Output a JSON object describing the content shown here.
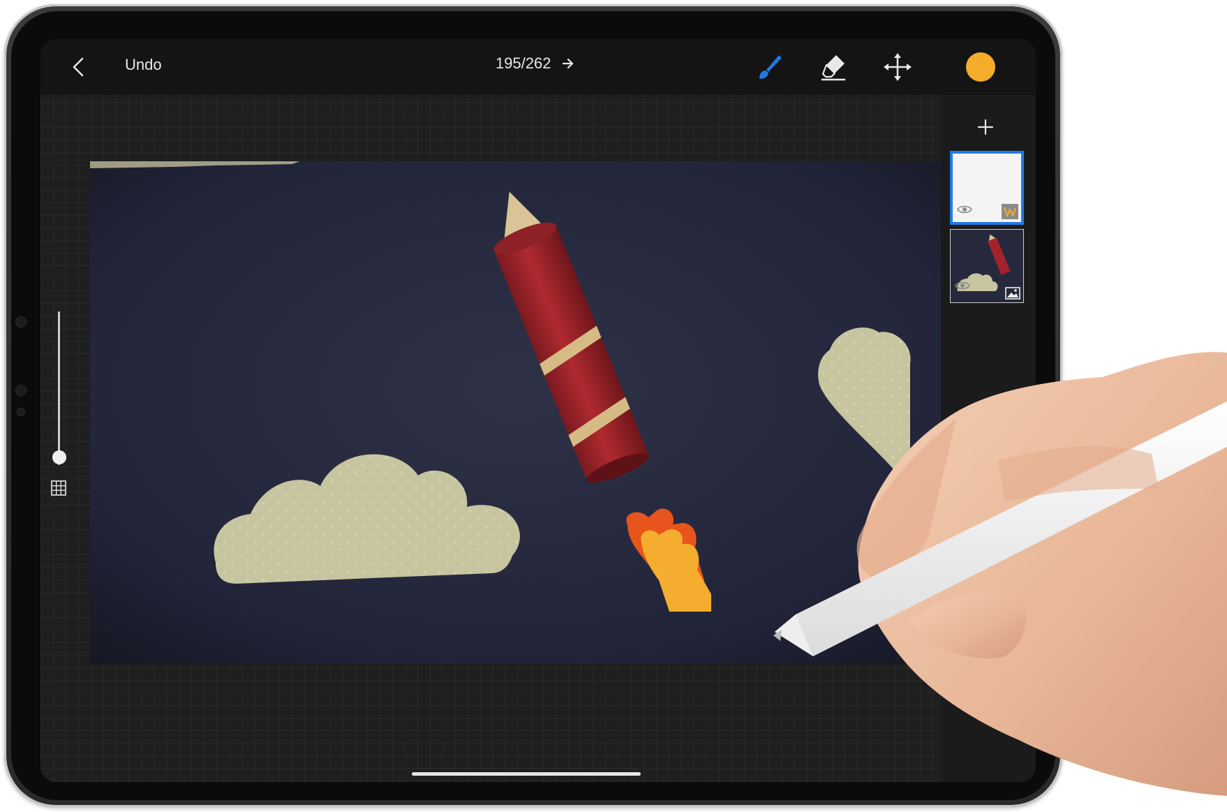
{
  "topbar": {
    "back_icon": "chevron-left-icon",
    "undo_label": "Undo",
    "frame_counter": "195/262",
    "next_icon": "arrow-right-icon"
  },
  "tools": [
    {
      "name": "brush",
      "icon": "brush-icon",
      "active": true
    },
    {
      "name": "eraser",
      "icon": "eraser-icon",
      "active": false
    },
    {
      "name": "move",
      "icon": "move-icon",
      "active": false
    }
  ],
  "colors": {
    "accent": "#1f7ae6",
    "current_color": "#f4ad2b",
    "topbar_bg": "#141414",
    "paper_bg": "#25283a",
    "rocket_red": "#a3232b",
    "cloud": "#c6c49e",
    "flame_orange": "#e8551c",
    "flame_yellow": "#f5ad2f"
  },
  "sidebar": {
    "add_icon": "plus-icon",
    "layers": [
      {
        "name": "drawing-layer",
        "selected": true,
        "visibility_icon": "eye-icon",
        "type_icon": "drawing-layer-icon"
      },
      {
        "name": "image-layer",
        "selected": false,
        "visibility_icon": "eye-icon",
        "type_icon": "image-icon"
      }
    ]
  },
  "left_controls": {
    "brush_size_level": 0.05,
    "grid_icon": "grid-icon"
  }
}
